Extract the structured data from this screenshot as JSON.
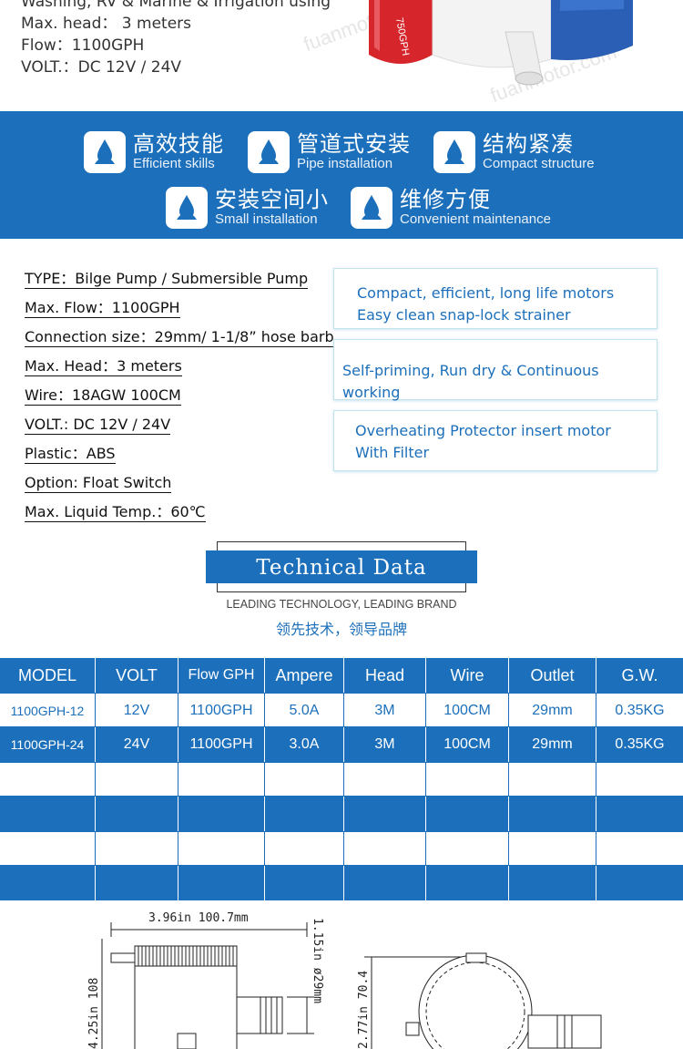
{
  "intro": {
    "lines": [
      "Washing, RV & Marine & Irrigation using",
      "Max. head： 3 meters",
      "Flow：1100GPH",
      "VOLT.：DC 12V / 24V"
    ],
    "watermark": "fuanmotor.com",
    "pump_label": "750GPH"
  },
  "features": [
    {
      "cn": "高效技能",
      "en": "Efficient skills",
      "icon": "water-drop-leaf-icon"
    },
    {
      "cn": "管道式安装",
      "en": "Pipe installation",
      "icon": "water-drop-leaf-icon"
    },
    {
      "cn": "结构紧凑",
      "en": "Compact structure",
      "icon": "water-drop-leaf-icon"
    },
    {
      "cn": "安装空间小",
      "en": "Small installation",
      "icon": "water-drop-leaf-icon"
    },
    {
      "cn": "维修方便",
      "en": "Convenient maintenance",
      "icon": "water-drop-leaf-icon"
    }
  ],
  "specs": [
    "TYPE：Bilge Pump / Submersible Pump",
    "Max. Flow：1100GPH",
    "Connection size：29mm/ 1-1/8”  hose barb",
    "Max. Head：3 meters",
    "Wire：18AGW 100CM ",
    "VOLT.: DC 12V / 24V",
    "Plastic：ABS",
    "Option: Float Switch",
    "Max. Liquid Temp.：60℃"
  ],
  "callouts": [
    [
      "Compact, efficient, long life motors",
      "Easy clean snap-lock strainer"
    ],
    [
      "Self-priming, Run dry & Continuous working"
    ],
    [
      "Overheating Protector insert motor",
      "With Filter"
    ]
  ],
  "technical": {
    "title": "Technical Data",
    "subtitle": "LEADING TECHNOLOGY, LEADING BRAND",
    "subtitle_cn": "领先技术，领导品牌"
  },
  "table": {
    "headers": [
      "MODEL",
      "VOLT",
      "Flow GPH",
      "Ampere",
      "Head",
      "Wire",
      "Outlet",
      "G.W."
    ],
    "rows": [
      [
        "1100GPH-12",
        "12V",
        "1100GPH",
        "5.0A",
        "3M",
        "100CM",
        "29mm",
        "0.35KG"
      ],
      [
        "1100GPH-24",
        "24V",
        "1100GPH",
        "3.0A",
        "3M",
        "100CM",
        "29mm",
        "0.35KG"
      ],
      [
        "",
        "",
        "",
        "",
        "",
        "",
        "",
        ""
      ],
      [
        "",
        "",
        "",
        "",
        "",
        "",
        "",
        ""
      ],
      [
        "",
        "",
        "",
        "",
        "",
        "",
        "",
        ""
      ],
      [
        "",
        "",
        "",
        "",
        "",
        "",
        "",
        ""
      ]
    ]
  },
  "drawing": {
    "width_label": "3.96in  100.7mm",
    "outlet_label": "1.15in  ø29mm",
    "height_label": "4.25in  108",
    "side_height_label": "2.77in  70.4"
  },
  "colors": {
    "brand_blue": "#1c6fba",
    "callout_border": "#bfe3ef"
  }
}
